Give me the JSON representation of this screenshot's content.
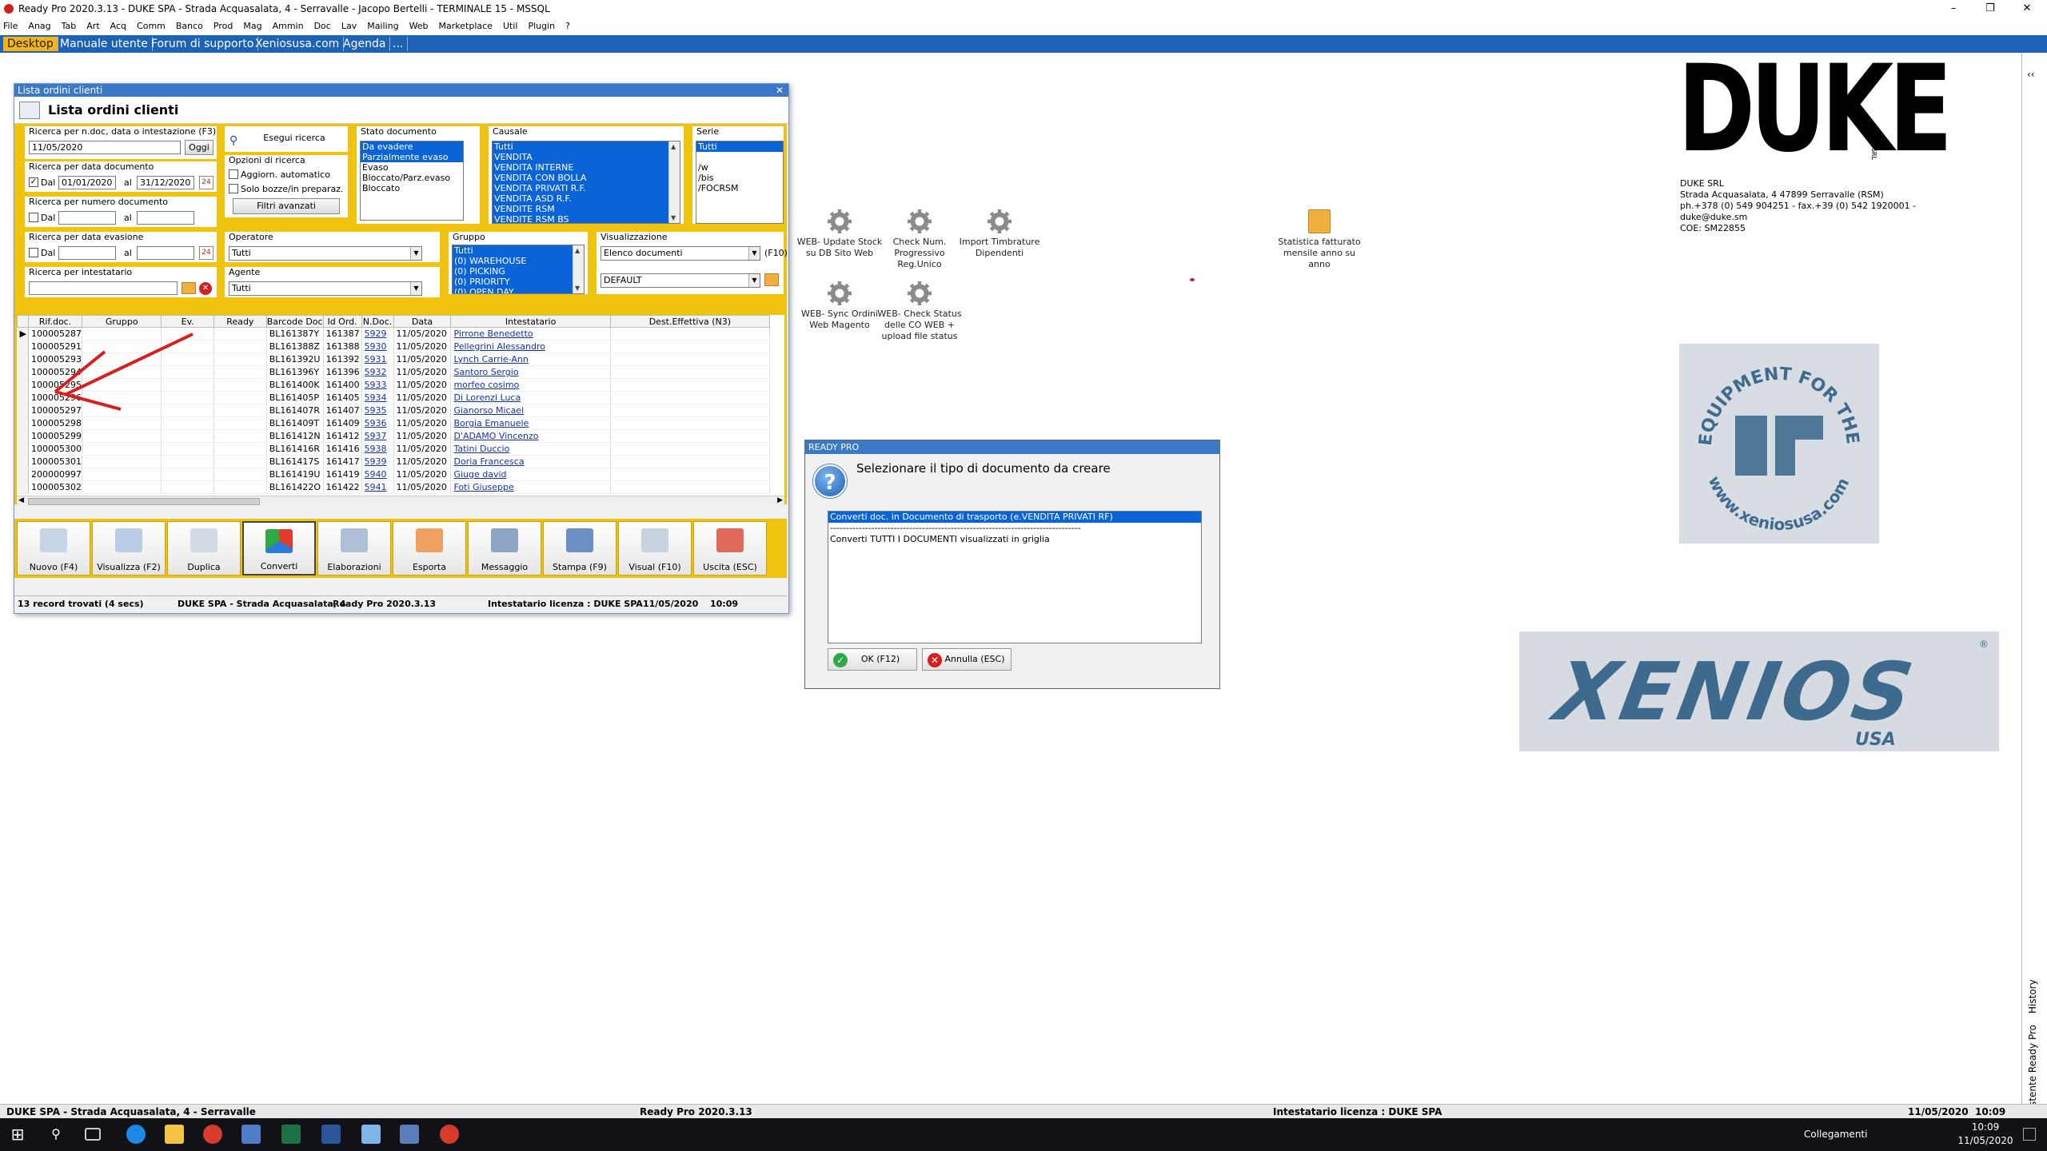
{
  "window_title": "Ready Pro 2020.3.13 - DUKE SPA - Strada Acquasalata, 4 - Serravalle - Jacopo Bertelli - TERMINALE 15 - MSSQL",
  "window_controls": [
    "–",
    "❐",
    "✕"
  ],
  "menu": [
    "File",
    "Anag",
    "Tab",
    "Art",
    "Acq",
    "Comm",
    "Banco",
    "Prod",
    "Mag",
    "Ammin",
    "Doc",
    "Lav",
    "Mailing",
    "Web",
    "Marketplace",
    "Util",
    "Plugin",
    "?"
  ],
  "tabs": [
    "Desktop",
    "Manuale utente",
    "Forum di supporto",
    "Xeniosusa.com",
    "Agenda",
    "..."
  ],
  "desktop_icons": [
    {
      "label": "WEB- Update Stock su DB Sito Web",
      "icon": "gear-icon"
    },
    {
      "label": "Check Num. Progressivo Reg.Unico",
      "icon": "gear-icon"
    },
    {
      "label": "Import Timbrature Dipendenti",
      "icon": "gear-icon"
    },
    {
      "label": "WEB- Sync Ordini Web Magento",
      "icon": "gear-icon"
    },
    {
      "label": "WEB- Check Status delle CO WEB + upload file status",
      "icon": "gear-icon"
    },
    {
      "label": "Statistica fatturato mensile anno su anno",
      "icon": "box-icon"
    }
  ],
  "list_window": {
    "title": "Lista ordini clienti",
    "header": "Lista ordini clienti",
    "search_doc_label": "Ricerca per n.doc, data o intestazione (F3)",
    "search_doc_value": "11/05/2020",
    "oggi_button": "Oggi",
    "esegui_button": "Esegui ricerca",
    "date_doc_label": "Ricerca per data documento",
    "dal": "Dal",
    "al": "al",
    "date_from": "01/01/2020",
    "date_to": "31/12/2020",
    "num_doc_label": "Ricerca per numero documento",
    "date_eva_label": "Ricerca per data evasione",
    "intestatario_label": "Ricerca per intestatario",
    "opzioni_label": "Opzioni di ricerca",
    "opt1": "Aggiorn. automatico",
    "opt2": "Solo bozze/in preparaz.",
    "filtri_button": "Filtri avanzati",
    "operatore_label": "Operatore",
    "operatore_value": "Tutti",
    "agente_label": "Agente",
    "agente_value": "Tutti",
    "stato_label": "Stato documento",
    "stato_items": [
      "Da evadere",
      "Parzialmente evaso",
      "Evaso",
      "Bloccato/Parz.evaso",
      "Bloccato"
    ],
    "causale_label": "Causale",
    "causale_items": [
      "Tutti",
      "VENDITA",
      "VENDITA INTERNE",
      "VENDITA CON BOLLA",
      "VENDITA PRIVATI R.F.",
      "VENDITA ASD R.F.",
      "VENDITE RSM",
      "VENDITE RSM BS"
    ],
    "serie_label": "Serie",
    "serie_items": [
      "Tutti",
      "",
      "/w",
      "/bis",
      "/FOCRSM"
    ],
    "gruppo_label": "Gruppo",
    "gruppo_items": [
      "Tutti",
      "(0) WAREHOUSE",
      "(0) PICKING",
      "(0) PRIORITY",
      "(0) OPEN DAY"
    ],
    "visual_label": "Visualizzazione",
    "visual_value": "Elenco documenti",
    "visual_hint": "(F10)",
    "visual_value2": "DEFAULT",
    "columns": [
      "Rif.doc.",
      "Gruppo",
      "Ev.",
      "Ready",
      "Barcode Doc",
      "Id Ord.",
      "N.Doc.",
      "Data",
      "Intestatario",
      "Dest.Effettiva (N3)"
    ],
    "rows": [
      [
        "100005287",
        "",
        "",
        "",
        "BL161387Y",
        "161387",
        "5929",
        "11/05/2020",
        "Pirrone Benedetto"
      ],
      [
        "100005291",
        "",
        "",
        "",
        "BL161388Z",
        "161388",
        "5930",
        "11/05/2020",
        "Pellegrini Alessandro"
      ],
      [
        "100005293",
        "",
        "",
        "",
        "BL161392U",
        "161392",
        "5931",
        "11/05/2020",
        "Lynch Carrie-Ann"
      ],
      [
        "100005294",
        "",
        "",
        "",
        "BL161396Y",
        "161396",
        "5932",
        "11/05/2020",
        "Santoro Sergio"
      ],
      [
        "100005295",
        "",
        "",
        "",
        "BL161400K",
        "161400",
        "5933",
        "11/05/2020",
        "morfeo cosimo"
      ],
      [
        "100005296",
        "",
        "",
        "",
        "BL161405P",
        "161405",
        "5934",
        "11/05/2020",
        "Di Lorenzi Luca"
      ],
      [
        "100005297",
        "",
        "",
        "",
        "BL161407R",
        "161407",
        "5935",
        "11/05/2020",
        "Gianorso Micael"
      ],
      [
        "100005298",
        "",
        "",
        "",
        "BL161409T",
        "161409",
        "5936",
        "11/05/2020",
        "Borgia Emanuele"
      ],
      [
        "100005299",
        "",
        "",
        "",
        "BL161412N",
        "161412",
        "5937",
        "11/05/2020",
        "D'ADAMO Vincenzo"
      ],
      [
        "100005300",
        "",
        "",
        "",
        "BL161416R",
        "161416",
        "5938",
        "11/05/2020",
        "Tatini Duccio"
      ],
      [
        "100005301",
        "",
        "",
        "",
        "BL161417S",
        "161417",
        "5939",
        "11/05/2020",
        "Doria Francesca"
      ],
      [
        "200000997",
        "",
        "",
        "",
        "BL161419U",
        "161419",
        "5940",
        "11/05/2020",
        "Giuge david"
      ],
      [
        "100005302",
        "",
        "",
        "",
        "BL161422O",
        "161422",
        "5941",
        "11/05/2020",
        "Foti Giuseppe "
      ]
    ],
    "toolbar": [
      "Nuovo (F4)",
      "Visualizza (F2)",
      "Duplica",
      "Converti",
      "Elaborazioni",
      "Esporta",
      "Messaggio",
      "Stampa (F9)",
      "Visual (F10)",
      "Uscita (ESC)"
    ],
    "status": [
      "13 record trovati (4 secs)",
      "DUKE SPA - Strada Acquasalata, 4",
      "Ready Pro 2020.3.13",
      "Intestatario licenza : DUKE SPA",
      "11/05/2020",
      "10:09"
    ]
  },
  "dialog": {
    "title": "READY PRO",
    "message": "Selezionare il tipo di documento da creare",
    "options": [
      "Converti doc. in Documento di trasporto (e.VENDITA PRIVATI RF)",
      "-------------------------------------------------------------------------------",
      "Converti TUTTI I DOCUMENTI visualizzati in griglia"
    ],
    "ok": "OK (F12)",
    "cancel": "Annulla (ESC)"
  },
  "duke_logo": {
    "text": "DUKE",
    "srl": "SRL",
    "line1": "DUKE SRL",
    "line2": "Strada Acquasalata, 4 47899 Serravalle (RSM)",
    "line3": "ph.+378 (0) 549 904251 - fax.+39 (0) 542 1920001 - duke@duke.sm",
    "line4": "COE: SM22855"
  },
  "eq_logo": {
    "top": "EQUIPMENT FOR THE FITTEST",
    "bottom": "www.xeniosusa.com"
  },
  "xenios_logo": {
    "text": "XENIOS",
    "sub": "USA",
    "reg": "®"
  },
  "side_panel": {
    "collapse": "‹‹",
    "labels": [
      "History",
      "Assistente Ready Pro"
    ]
  },
  "bottom_status": [
    "DUKE SPA - Strada Acquasalata, 4 - Serravalle",
    "Ready Pro 2020.3.13",
    "Intestatario licenza : DUKE SPA",
    "11/05/2020",
    "10:09"
  ],
  "taskbar": {
    "tray_label": "Collegamenti",
    "time": "10:09",
    "date": "11/05/2020"
  }
}
